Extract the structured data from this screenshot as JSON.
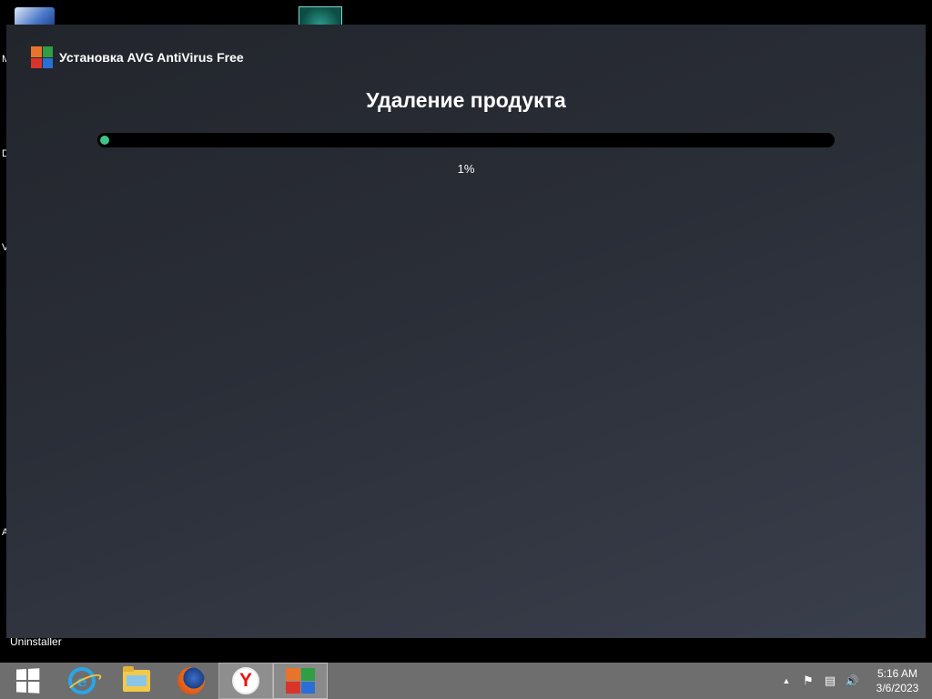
{
  "desktop": {
    "fragments": [
      "M",
      "D",
      "V",
      "A"
    ],
    "uninstaller_label": "Uninstaller"
  },
  "installer": {
    "window_title": "Установка AVG AntiVirus Free",
    "heading": "Удаление продукта",
    "progress_percent": 1,
    "progress_text": "1%",
    "accent_color": "#3fc28a"
  },
  "taskbar": {
    "items": [
      {
        "icon": "windows-start-icon"
      },
      {
        "icon": "internet-explorer-icon"
      },
      {
        "icon": "file-explorer-icon"
      },
      {
        "icon": "firefox-icon"
      },
      {
        "icon": "yandex-browser-icon",
        "glyph": "Y"
      },
      {
        "icon": "avg-icon"
      }
    ],
    "tray": {
      "show_hidden": "▲",
      "flag": "⚑",
      "network": "▤",
      "volume": "🔊"
    },
    "clock": {
      "time": "5:16 AM",
      "date": "3/6/2023"
    }
  }
}
